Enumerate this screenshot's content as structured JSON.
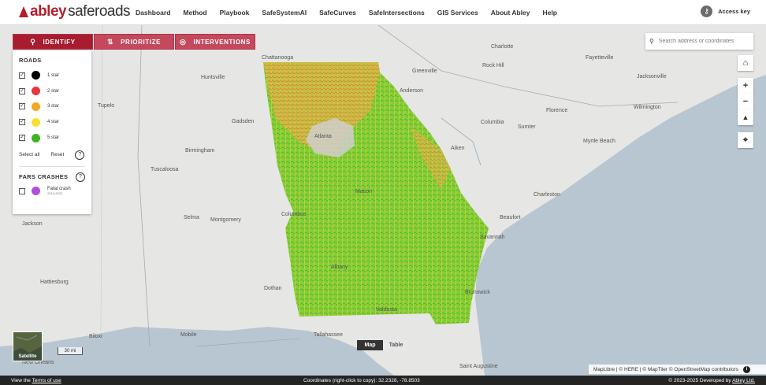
{
  "header": {
    "logo_brand": "abley",
    "logo_product": "saferoads",
    "nav": [
      "Dashboard",
      "Method",
      "Playbook",
      "SafeSystemAI",
      "SafeCurves",
      "SafeIntersections",
      "GIS Services",
      "About Abley",
      "Help"
    ],
    "access_key_label": "Access key"
  },
  "tabs": [
    {
      "label": "IDENTIFY",
      "icon": "search-icon",
      "active": true
    },
    {
      "label": "PRIORITIZE",
      "icon": "sort-icon",
      "active": false
    },
    {
      "label": "INTERVENTIONS",
      "icon": "target-icon",
      "active": false
    }
  ],
  "legend": {
    "roads_title": "ROADS",
    "roads": [
      {
        "label": "1 star",
        "color": "#000000",
        "checked": true
      },
      {
        "label": "2 star",
        "color": "#e8363a",
        "checked": true
      },
      {
        "label": "3 star",
        "color": "#f5a623",
        "checked": true
      },
      {
        "label": "4 star",
        "color": "#f7e12f",
        "checked": true
      },
      {
        "label": "5 star",
        "color": "#3cb521",
        "checked": true
      }
    ],
    "select_all": "Select all",
    "reset": "Reset",
    "fars_title": "FARS CRASHES",
    "fars_item": {
      "label": "Fatal crash",
      "sub": "2013-2022",
      "color": "#b050e0",
      "checked": false
    }
  },
  "search": {
    "placeholder": "Search address or coordinates"
  },
  "controls": [
    "home-icon",
    "zoom-in-icon",
    "zoom-out-icon",
    "compass-icon",
    "locate-icon"
  ],
  "map_labels": [
    "Chattanooga",
    "Charlotte",
    "Fayetteville",
    "Huntsville",
    "Greenville",
    "Rock Hill",
    "Jacksonville",
    "Tupelo",
    "Anderson",
    "Florence",
    "Wilmington",
    "Gadsden",
    "Columbia",
    "Sumter",
    "Birmingham",
    "Atlanta",
    "Aiken",
    "Myrtle Beach",
    "Tuscaloosa",
    "Charleston",
    "Selma",
    "Montgomery",
    "Columbus",
    "Beaufort",
    "Jackson",
    "Savannah",
    "Hattiesburg",
    "Dothan",
    "Brunswick",
    "Biloxi",
    "Tallahassee",
    "Mobile",
    "Saint Augustine",
    "New Orleans",
    "Macon",
    "Albany",
    "Valdosta"
  ],
  "satellite_label": "Satellite",
  "scale_label": "30 mi",
  "view_toggle": {
    "map": "Map",
    "table": "Table",
    "active": "Map"
  },
  "attribution": "MapLibre | © HERE | © MapTiler © OpenStreetMap contributors",
  "footer": {
    "view_the": "View the ",
    "terms": "Terms of use",
    "coords": "Coordinates (right-click to copy): 32.2328, -78.8503",
    "copyright": "© 2023-2025 Developed by ",
    "developer": "Abley Ltd."
  }
}
